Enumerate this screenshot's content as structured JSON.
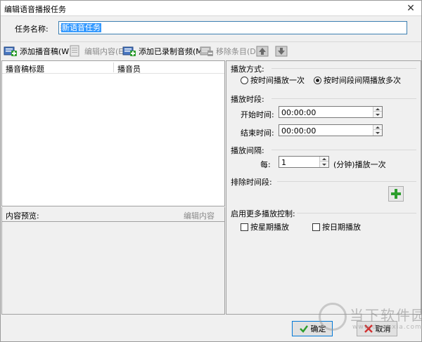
{
  "window": {
    "title": "编辑语音播报任务"
  },
  "task": {
    "name_label": "任务名称:",
    "name_value": "新语音任务"
  },
  "toolbar": {
    "add_script": "添加播音稿(W)",
    "edit_content": "编辑内容(E)",
    "add_recorded": "添加已录制音频(M)",
    "remove_item": "移除条目(D)"
  },
  "list": {
    "col_title": "播音稿标题",
    "col_announcer": "播音员"
  },
  "preview": {
    "label": "内容预览:",
    "edit": "编辑内容"
  },
  "play_mode": {
    "title": "播放方式:",
    "option_once": "按时间播放一次",
    "option_interval": "按时间段间隔播放多次",
    "selected": "option_interval"
  },
  "play_period": {
    "title": "播放时段:",
    "start_label": "开始时间:",
    "start_value": "00:00:00",
    "end_label": "结束时间:",
    "end_value": "00:00:00"
  },
  "interval": {
    "title": "播放间隔:",
    "every_label": "每:",
    "value": "1",
    "suffix": "(分钟)播放一次"
  },
  "exclude": {
    "title": "排除时间段:"
  },
  "more_control": {
    "title": "启用更多播放控制:",
    "by_week": "按星期播放",
    "by_date": "按日期播放"
  },
  "footer": {
    "ok": "确定",
    "cancel": "取消"
  },
  "watermark": {
    "text": "当下软件园",
    "sub": "www.downxia.com"
  },
  "colors": {
    "accent": "#0078d7",
    "green": "#2e9e2e",
    "selection": "#3399ff"
  }
}
